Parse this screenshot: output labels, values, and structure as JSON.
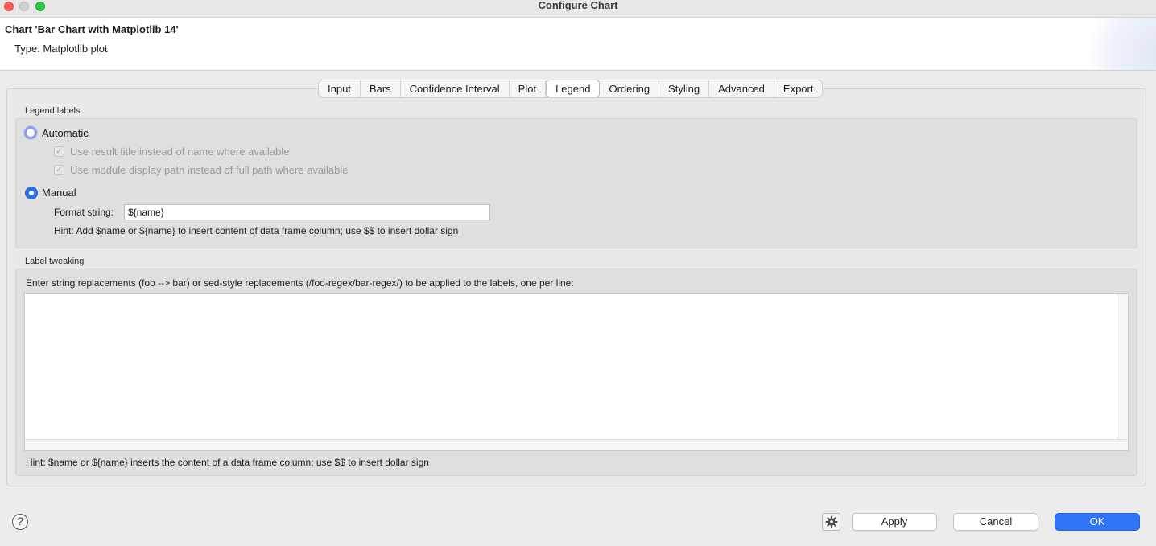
{
  "window": {
    "title": "Configure Chart"
  },
  "header": {
    "chart_name": "Chart 'Bar Chart with Matplotlib 14'",
    "chart_type": "Type: Matplotlib plot"
  },
  "tabs": [
    {
      "label": "Input"
    },
    {
      "label": "Bars"
    },
    {
      "label": "Confidence Interval"
    },
    {
      "label": "Plot"
    },
    {
      "label": "Legend"
    },
    {
      "label": "Ordering"
    },
    {
      "label": "Styling"
    },
    {
      "label": "Advanced"
    },
    {
      "label": "Export"
    }
  ],
  "active_tab": "Legend",
  "legend_labels": {
    "group_title": "Legend labels",
    "automatic_label": "Automatic",
    "automatic_selected": false,
    "use_result_title_label": "Use result title instead of name where available",
    "use_result_title_checked": true,
    "use_display_path_label": "Use module display path instead of full path where available",
    "use_display_path_checked": true,
    "manual_label": "Manual",
    "manual_selected": true,
    "format_string_label": "Format string:",
    "format_string_value": "${name}",
    "hint": "Hint: Add $name or ${name} to insert content of data frame column; use $$ to insert dollar sign"
  },
  "label_tweaking": {
    "group_title": "Label tweaking",
    "instructions": "Enter string replacements (foo --> bar) or sed-style replacements (/foo-regex/bar-regex/) to be applied to the labels, one per line:",
    "replacements_value": "",
    "hint": "Hint: $name or ${name} inserts the content of a data frame column; use $$ to insert dollar sign"
  },
  "footer": {
    "help_glyph": "?",
    "apply_label": "Apply",
    "cancel_label": "Cancel",
    "ok_label": "OK"
  },
  "icons": {
    "help": "question-circle-icon",
    "settings": "gear-icon",
    "check": "checkmark-icon"
  },
  "colors": {
    "accent": "#2f74f6",
    "close": "#fe5f57",
    "maximize": "#28c840"
  }
}
